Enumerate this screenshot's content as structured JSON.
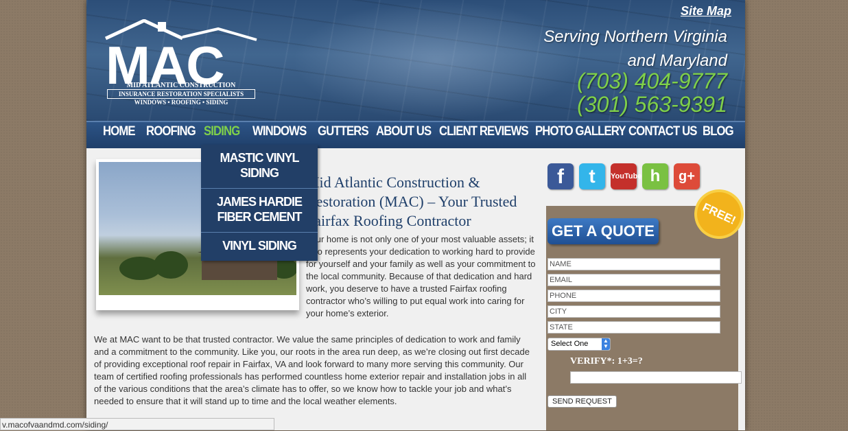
{
  "header": {
    "site_map": "Site Map",
    "serving_line1": "Serving Northern Virginia",
    "serving_line2": "and Maryland",
    "phone1": "(703) 404-9777",
    "phone2": "(301) 563-9391"
  },
  "logo": {
    "mac": "MAC",
    "line1": "MID ATLANTIC CONSTRUCTION",
    "line2": "INSURANCE RESTORATION SPECIALISTS",
    "line3": "WINDOWS • ROOFING • SIDING"
  },
  "nav": {
    "items": [
      "HOME",
      "ROOFING",
      "SIDING",
      "WINDOWS",
      "GUTTERS",
      "ABOUT US",
      "CLIENT REVIEWS",
      "PHOTO GALLERY",
      "CONTACT US",
      "BLOG"
    ],
    "active": "SIDING"
  },
  "dropdown": {
    "items": [
      "MASTIC VINYL SIDING",
      "JAMES HARDIE FIBER CEMENT",
      "VINYL SIDING"
    ]
  },
  "main": {
    "heading": "Mid Atlantic Construction & Restoration (MAC) – Your Trusted Fairfax Roofing Contractor",
    "intro": "Your home is not only one of your most valuable assets; it also represents your dedication to working hard to provide for yourself and your family as well as your commitment to the local community. Because of that dedication and hard work, you deserve to have a trusted Fairfax roofing contractor who’s willing to put equal work into caring for your home’s exterior.",
    "body": "We at MAC want to be that trusted contractor. We value the same principles of dedication to work and family and a commitment to the community. Like you, our roots in the area run deep, as we’re closing out first decade of providing exceptional roof repair in Fairfax, VA and look forward to many more serving this community. Our team of certified roofing professionals has performed countless home exterior repair and installation jobs in all of the various conditions that the area’s climate has to offer, so we know how to tackle your job and what’s needed to ensure that it will stand up to time and the local weather elements."
  },
  "social": {
    "icons": [
      "facebook-icon",
      "twitter-icon",
      "youtube-icon",
      "houzz-icon",
      "google-plus-icon"
    ],
    "youtube_label": "YouTube",
    "facebook_glyph": "f",
    "twitter_glyph": "t",
    "houzz_glyph": "h",
    "google_glyph": "g+"
  },
  "quote": {
    "button": "GET A QUOTE",
    "badge": "FREE!",
    "fields": [
      "NAME",
      "EMAIL",
      "PHONE",
      "CITY",
      "STATE"
    ],
    "select": "Select One",
    "verify": "VERIFY*: 1+3=?",
    "send": "SEND REQUEST"
  },
  "status_bar": "v.macofvaandmd.com/siding/",
  "colors": {
    "nav_bg": "#2d5486",
    "accent_green": "#7fd04a",
    "quote_box": "#8c7a66",
    "quote_button": "#2d65ad"
  }
}
